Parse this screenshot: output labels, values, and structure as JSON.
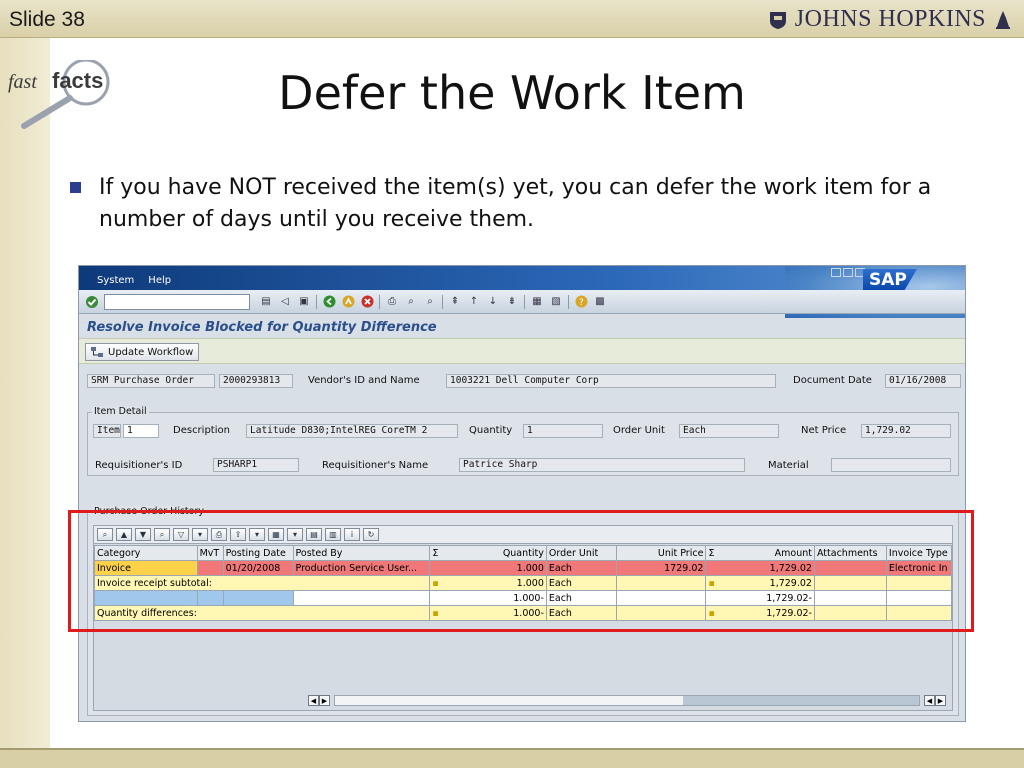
{
  "slide": {
    "number": "Slide 38",
    "title": "Defer the Work Item",
    "bullet": "If you have NOT received the item(s) yet, you can defer the work item for a number of days until you receive them."
  },
  "brand": {
    "institution": "JOHNS HOPKINS",
    "fastfacts_a": "fast",
    "fastfacts_b": "facts"
  },
  "colors": {
    "sap_blue": "#2c68b8",
    "highlight_red": "#e11b1b",
    "bullet_blue": "#2a3d8f"
  },
  "sap": {
    "logo": "SAP",
    "menu": [
      "System",
      "Help"
    ],
    "screen_title": "Resolve Invoice Blocked for Quantity Difference",
    "update_button": "Update Workflow",
    "header": {
      "po_label": "SRM Purchase Order",
      "po_value": "2000293813",
      "vendor_label": "Vendor's ID and Name",
      "vendor_value": "1003221 Dell Computer Corp",
      "docdate_label": "Document Date",
      "docdate_value": "01/16/2008"
    },
    "item_detail": {
      "group_label": "Item Detail",
      "item_label": "Item",
      "item_value": "1",
      "desc_label": "Description",
      "desc_value": "Latitude D830;IntelREG CoreTM 2",
      "qty_label": "Quantity",
      "qty_value": "1",
      "unit_label": "Order Unit",
      "unit_value": "Each",
      "price_label": "Net Price",
      "price_value": "1,729.02",
      "req_id_label": "Requisitioner's ID",
      "req_id_value": "PSHARP1",
      "req_name_label": "Requisitioner's Name",
      "req_name_value": "Patrice Sharp",
      "material_label": "Material",
      "material_value": ""
    },
    "po_history": {
      "group_label": "Purchase Order History",
      "columns": [
        "Category",
        "MvT",
        "Posting Date",
        "Posted By",
        "Σ",
        "Quantity",
        "Order Unit",
        "Unit Price",
        "Σ",
        "Amount",
        "Attachments",
        "Invoice Type"
      ],
      "rows": [
        {
          "cells": [
            "Invoice",
            "",
            "01/20/2008",
            "Production Service User...",
            "",
            "1.000",
            "Each",
            "1729.02",
            "",
            "1,729.02",
            "",
            "Electronic In"
          ]
        },
        {
          "cells": [
            "Invoice receipt subtotal:",
            "",
            "",
            "",
            "▪",
            "1.000",
            "Each",
            "",
            "▪",
            "1,729.02",
            "",
            ""
          ]
        },
        {
          "cells": [
            "",
            "",
            "",
            "",
            "",
            "1.000-",
            "Each",
            "",
            "",
            "1,729.02-",
            "",
            ""
          ]
        },
        {
          "cells": [
            "Quantity differences:",
            "",
            "",
            "",
            "▪",
            "1.000-",
            "Each",
            "",
            "▪",
            "1,729.02-",
            "",
            ""
          ]
        }
      ]
    }
  }
}
